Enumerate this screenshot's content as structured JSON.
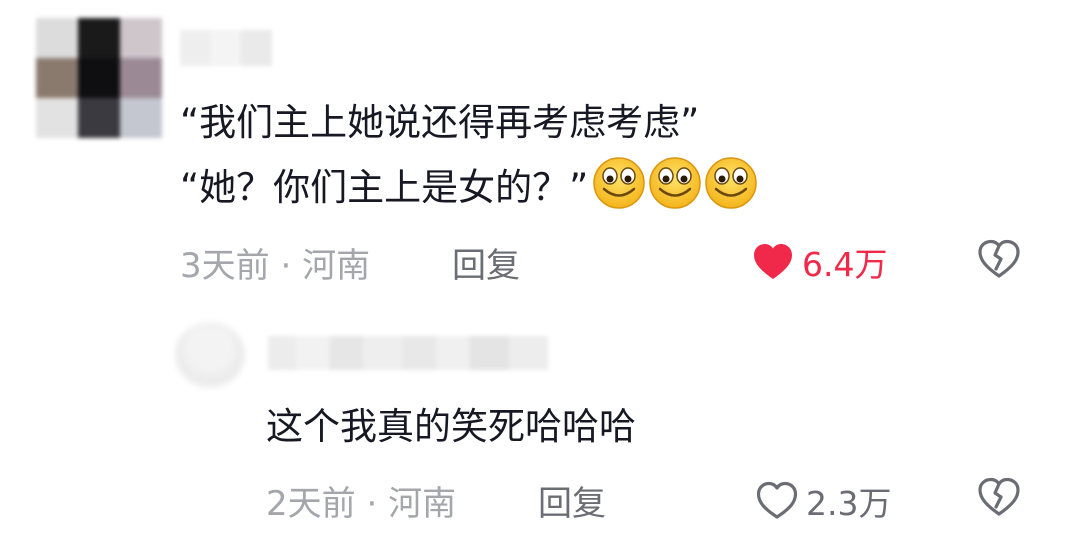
{
  "comments": [
    {
      "text_line1": "“我们主上她说还得再考虑考虑”",
      "text_line2": "“她？你们主上是女的？”",
      "emojis": [
        "smile-emoji",
        "smile-emoji",
        "smile-emoji"
      ],
      "time": "3天前",
      "separator": "·",
      "location": "河南",
      "reply_label": "回复",
      "likes": "6.4万",
      "liked": true,
      "like_color": "#f02849"
    },
    {
      "text": "这个我真的笑死哈哈哈",
      "time": "2天前",
      "separator": "·",
      "location": "河南",
      "reply_label": "回复",
      "likes": "2.3万",
      "liked": false
    }
  ],
  "icons": {
    "like": "heart-icon",
    "dislike": "broken-heart-icon"
  }
}
